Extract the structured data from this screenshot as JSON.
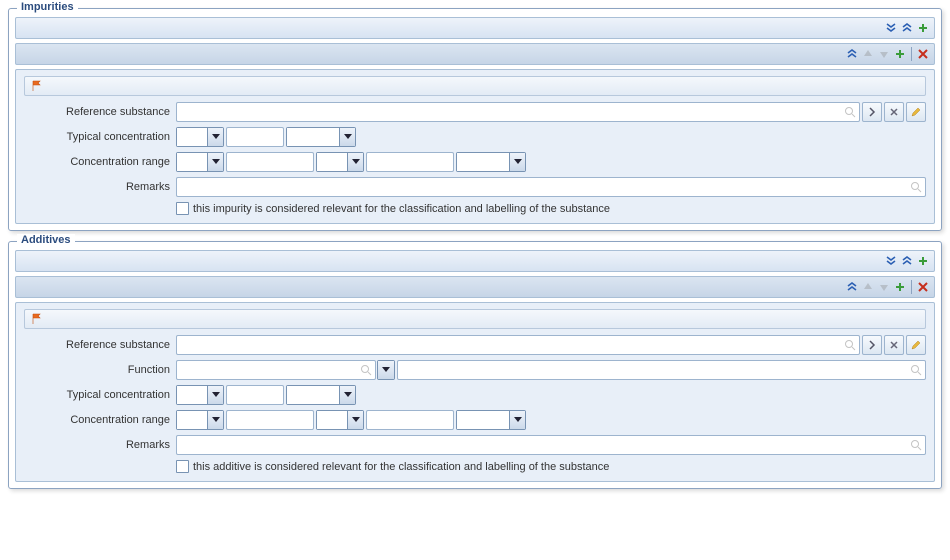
{
  "sections": {
    "impurities": {
      "title": "Impurities",
      "fields": {
        "reference_substance": "Reference substance",
        "typical_concentration": "Typical concentration",
        "concentration_range": "Concentration range",
        "remarks": "Remarks"
      },
      "checkbox_label": "this impurity is considered relevant for the classification and labelling of the substance"
    },
    "additives": {
      "title": "Additives",
      "fields": {
        "reference_substance": "Reference substance",
        "function": "Function",
        "typical_concentration": "Typical concentration",
        "concentration_range": "Concentration range",
        "remarks": "Remarks"
      },
      "checkbox_label": "this additive is considered relevant for the classification and labelling of the substance"
    }
  }
}
